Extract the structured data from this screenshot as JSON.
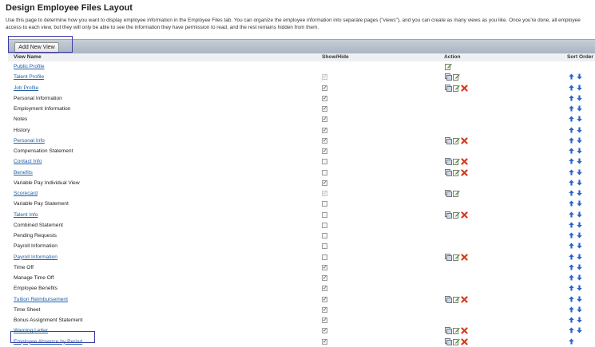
{
  "page": {
    "title": "Design Employee Files Layout",
    "intro": "Use this page to determine how you want to display employee information in the Employee Files tab. You can organize the employee information into separate pages (\"views\"), and you can create as many views as you like. Once you're done, all employee",
    "intro2": "access to each view, but they will only be able to see the information they have permission to read, and the rest remains hidden from them."
  },
  "toolbar": {
    "add_label": "Add New View"
  },
  "columns": {
    "name": "View Name",
    "show": "Show/Hide",
    "action": "Action",
    "sort": "Sort Order"
  },
  "colors": {
    "link": "#1f5fa8",
    "toolbar": "#aab5c2",
    "highlight": "#3b3ba6",
    "arrow": "#2a63c9",
    "delete": "#d63a1d"
  },
  "rows": [
    {
      "name": "Public Profile",
      "link": true,
      "check": "none",
      "actions": [
        "edit"
      ],
      "sort": []
    },
    {
      "name": "Talent Profile",
      "link": true,
      "check": "disabled",
      "actions": [
        "copy",
        "edit"
      ],
      "sort": [
        "up",
        "down"
      ]
    },
    {
      "name": "Job Profile",
      "link": true,
      "check": "checked",
      "actions": [
        "copy",
        "edit",
        "delete"
      ],
      "sort": [
        "up",
        "down"
      ]
    },
    {
      "name": "Personal Information",
      "link": false,
      "check": "checked",
      "actions": [],
      "sort": [
        "up",
        "down"
      ]
    },
    {
      "name": "Employment Information",
      "link": false,
      "check": "checked",
      "actions": [],
      "sort": [
        "up",
        "down"
      ]
    },
    {
      "name": "Notes",
      "link": false,
      "check": "checked",
      "actions": [],
      "sort": [
        "up",
        "down"
      ]
    },
    {
      "name": "History",
      "link": false,
      "check": "checked",
      "actions": [],
      "sort": [
        "up",
        "down"
      ]
    },
    {
      "name": "Personal Info",
      "link": true,
      "check": "checked",
      "actions": [
        "copy",
        "edit",
        "delete"
      ],
      "sort": [
        "up",
        "down"
      ]
    },
    {
      "name": "Compensation Statement",
      "link": false,
      "check": "checked",
      "actions": [],
      "sort": [
        "up",
        "down"
      ]
    },
    {
      "name": "Contact Info",
      "link": true,
      "check": "unchecked",
      "actions": [
        "copy",
        "edit",
        "delete"
      ],
      "sort": [
        "up",
        "down"
      ]
    },
    {
      "name": "Benefits",
      "link": true,
      "check": "unchecked",
      "actions": [
        "copy",
        "edit",
        "delete"
      ],
      "sort": [
        "up",
        "down"
      ]
    },
    {
      "name": "Variable Pay Individual View",
      "link": false,
      "check": "checked",
      "actions": [],
      "sort": [
        "up",
        "down"
      ]
    },
    {
      "name": "Scorecard",
      "link": true,
      "check": "disabled",
      "actions": [
        "copy",
        "edit"
      ],
      "sort": [
        "up",
        "down"
      ]
    },
    {
      "name": "Variable Pay Statement",
      "link": false,
      "check": "unchecked",
      "actions": [],
      "sort": [
        "up",
        "down"
      ]
    },
    {
      "name": "Talent Info",
      "link": true,
      "check": "unchecked",
      "actions": [
        "copy",
        "edit",
        "delete"
      ],
      "sort": [
        "up",
        "down"
      ]
    },
    {
      "name": "Combined Statement",
      "link": false,
      "check": "unchecked",
      "actions": [],
      "sort": [
        "up",
        "down"
      ]
    },
    {
      "name": "Pending Requests",
      "link": false,
      "check": "unchecked",
      "actions": [],
      "sort": [
        "up",
        "down"
      ]
    },
    {
      "name": "Payroll Information",
      "link": false,
      "check": "unchecked",
      "actions": [],
      "sort": [
        "up",
        "down"
      ]
    },
    {
      "name": "Payroll Information",
      "link": true,
      "check": "unchecked",
      "actions": [
        "copy",
        "edit",
        "delete"
      ],
      "sort": [
        "up",
        "down"
      ]
    },
    {
      "name": "Time Off",
      "link": false,
      "check": "checked",
      "actions": [],
      "sort": [
        "up",
        "down"
      ]
    },
    {
      "name": "Manage Time Off",
      "link": false,
      "check": "checked",
      "actions": [],
      "sort": [
        "up",
        "down"
      ]
    },
    {
      "name": "Employee Benefits",
      "link": false,
      "check": "checked",
      "actions": [],
      "sort": [
        "up",
        "down"
      ]
    },
    {
      "name": "Tuition Reimbursement",
      "link": true,
      "check": "checked",
      "actions": [
        "copy",
        "edit",
        "delete"
      ],
      "sort": [
        "up",
        "down"
      ]
    },
    {
      "name": "Time Sheet",
      "link": false,
      "check": "checked",
      "actions": [],
      "sort": [
        "up",
        "down"
      ]
    },
    {
      "name": "Bonus Assignment Statement",
      "link": false,
      "check": "checked",
      "actions": [],
      "sort": [
        "up",
        "down"
      ]
    },
    {
      "name": "Warning Letter",
      "link": true,
      "check": "checked",
      "actions": [
        "copy",
        "edit",
        "delete"
      ],
      "sort": [
        "up",
        "down"
      ]
    },
    {
      "name": "Employee Absence by Period",
      "link": true,
      "check": "checked",
      "actions": [
        "copy",
        "edit",
        "delete"
      ],
      "sort": [
        "up"
      ]
    }
  ]
}
